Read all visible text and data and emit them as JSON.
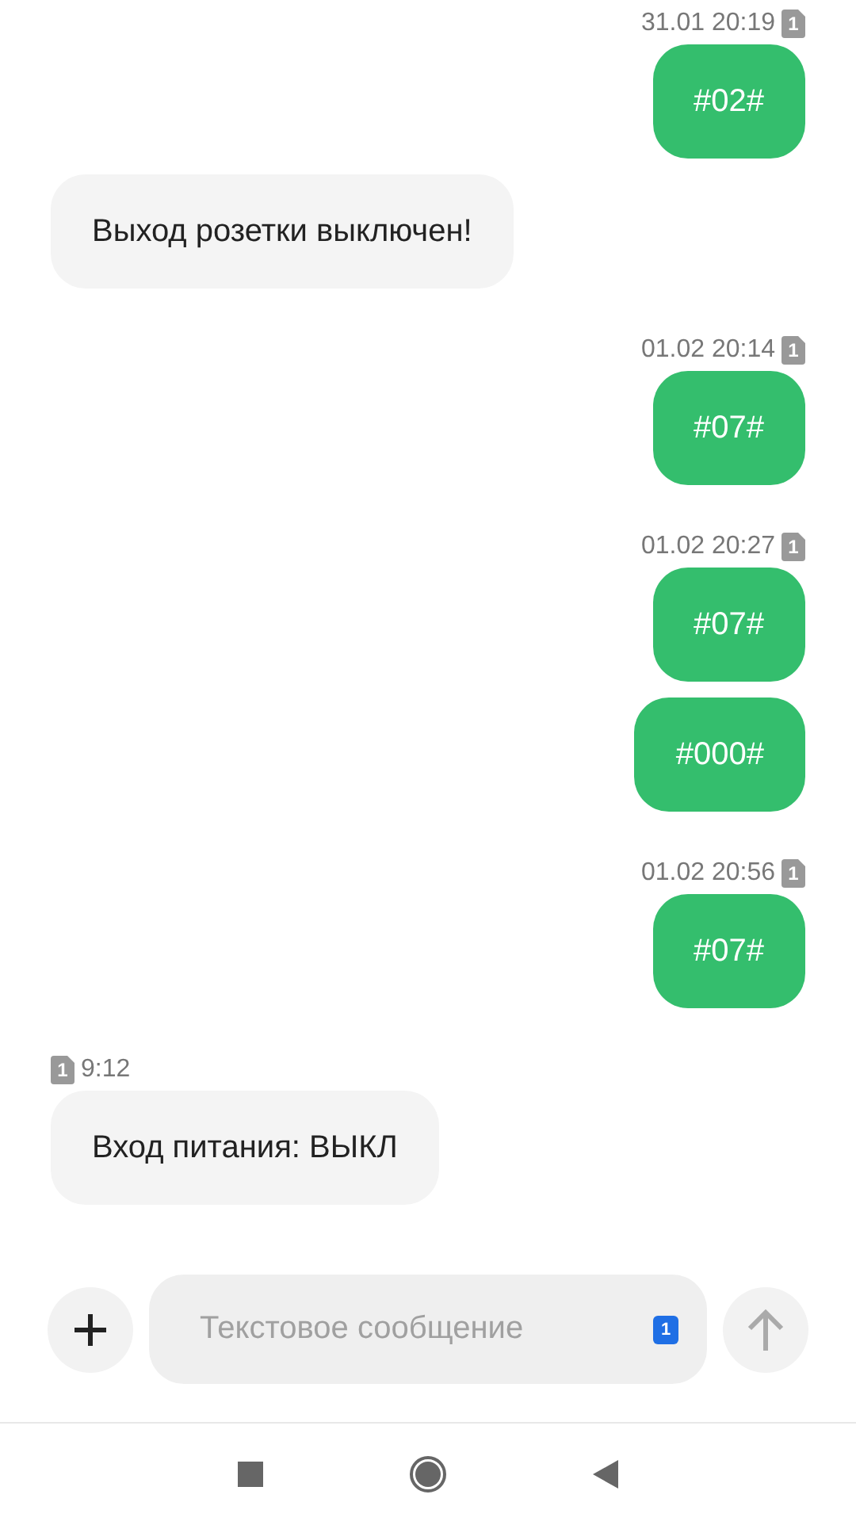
{
  "thread": [
    {
      "kind": "time",
      "outgoing": true,
      "text": "31.01 20:19",
      "sim": "1"
    },
    {
      "kind": "message",
      "outgoing": true,
      "text": "#02#"
    },
    {
      "kind": "message",
      "outgoing": false,
      "text": "Выход розетки выключен!"
    },
    {
      "kind": "time",
      "outgoing": true,
      "text": "01.02 20:14",
      "sim": "1"
    },
    {
      "kind": "message",
      "outgoing": true,
      "text": "#07#"
    },
    {
      "kind": "time",
      "outgoing": true,
      "text": "01.02 20:27",
      "sim": "1"
    },
    {
      "kind": "message",
      "outgoing": true,
      "text": "#07#"
    },
    {
      "kind": "message",
      "outgoing": true,
      "text": "#000#"
    },
    {
      "kind": "time",
      "outgoing": true,
      "text": "01.02 20:56",
      "sim": "1"
    },
    {
      "kind": "message",
      "outgoing": true,
      "text": "#07#"
    },
    {
      "kind": "time",
      "outgoing": false,
      "text": "9:12",
      "sim": "1"
    },
    {
      "kind": "message",
      "outgoing": false,
      "text": "Вход питания: ВЫКЛ"
    }
  ],
  "composer": {
    "placeholder": "Текстовое сообщение",
    "sim": "1"
  }
}
